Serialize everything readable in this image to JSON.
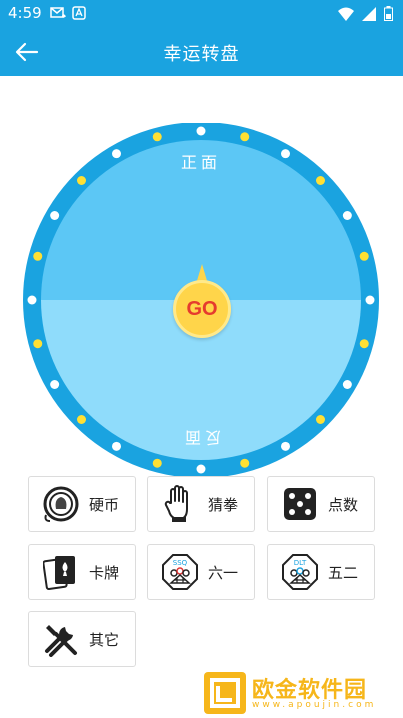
{
  "status_bar": {
    "time": "4:59"
  },
  "app_bar": {
    "title": "幸运转盘"
  },
  "wheel": {
    "top_label": "正面",
    "bottom_label": "反面",
    "go_label": "GO",
    "colors": {
      "ring": "#1aa3e0",
      "top_half": "#5cc7f5",
      "bottom_half": "#8fdcfb",
      "dot_yellow": "#ffe033",
      "dot_white": "#ffffff"
    }
  },
  "options": [
    {
      "label": "硬币",
      "icon": "coin-icon"
    },
    {
      "label": "猜拳",
      "icon": "hand-icon"
    },
    {
      "label": "点数",
      "icon": "dice-icon"
    },
    {
      "label": "卡牌",
      "icon": "cards-icon"
    },
    {
      "label": "六一",
      "icon": "lottery-ssq-icon",
      "badge": "SSQ"
    },
    {
      "label": "五二",
      "icon": "lottery-dlt-icon",
      "badge": "DLT"
    },
    {
      "label": "其它",
      "icon": "tools-icon"
    }
  ],
  "watermark": {
    "name": "欧金软件园",
    "url": "www.apoujin.com"
  }
}
